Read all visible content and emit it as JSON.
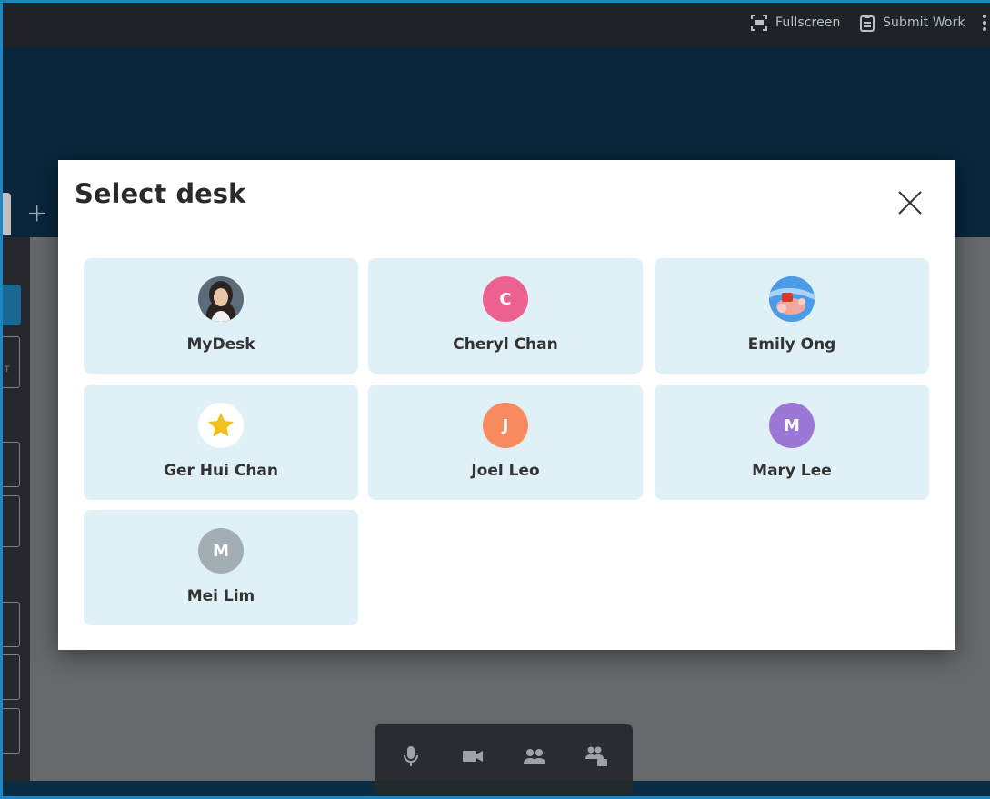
{
  "topbar": {
    "fullscreen_label": "Fullscreen",
    "submit_label": "Submit Work"
  },
  "tabs": {
    "add_label": "+"
  },
  "left_panel": {
    "snippet_text": "T"
  },
  "modal": {
    "title": "Select desk",
    "desks": [
      {
        "name": "MyDesk",
        "initial": "",
        "avatar_type": "photo-woman",
        "color": "#4a3a33"
      },
      {
        "name": "Cheryl Chan",
        "initial": "C",
        "avatar_type": "initial",
        "color": "#ec6190"
      },
      {
        "name": "Emily Ong",
        "initial": "",
        "avatar_type": "photo-cartoon",
        "color": "#3d8ee0"
      },
      {
        "name": "Ger Hui Chan",
        "initial": "",
        "avatar_type": "star-icon",
        "color": "#f2c01c"
      },
      {
        "name": "Joel Leo",
        "initial": "J",
        "avatar_type": "initial",
        "color": "#f78a5e"
      },
      {
        "name": "Mary Lee",
        "initial": "M",
        "avatar_type": "initial",
        "color": "#9b77d6"
      },
      {
        "name": "Mei Lim",
        "initial": "M",
        "avatar_type": "initial",
        "color": "#a3adb4"
      }
    ]
  },
  "call_toolbar": {
    "icons": [
      "microphone-icon",
      "video-camera-icon",
      "participants-icon",
      "breakout-rooms-icon"
    ]
  },
  "colors": {
    "frame": "#1d86c4",
    "app_background": "#0b2f49",
    "card_background": "#dff0f6"
  }
}
